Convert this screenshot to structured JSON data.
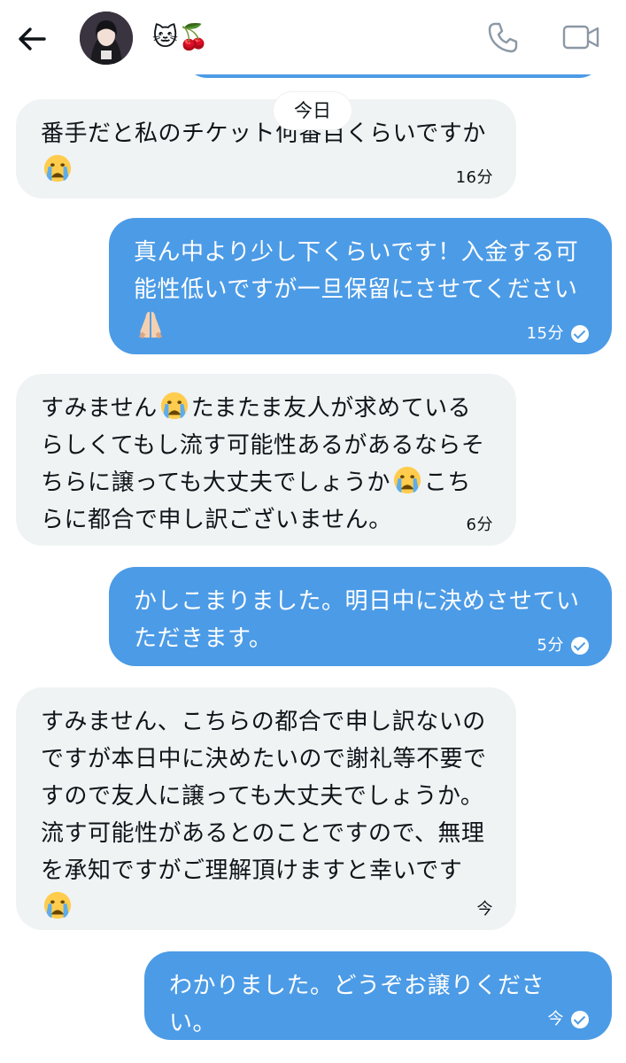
{
  "header": {
    "contact_name": "🐱🍒",
    "icons": [
      "back-arrow-icon",
      "phone-icon",
      "video-camera-icon"
    ]
  },
  "date_divider": "今日",
  "messages": [
    {
      "direction": "received",
      "text_1": "番手だと私のチケット何番目くらいですか",
      "emoji_1": "crying-face",
      "time": "16分"
    },
    {
      "direction": "sent",
      "text_1": "真ん中より少し下くらいです！入金する可能性低いですが一旦保留にさせてください",
      "emoji_1": "folded-hands",
      "time": "15分",
      "read": true
    },
    {
      "direction": "received",
      "text_1": "すみません",
      "emoji_1": "crying-face",
      "text_2": "たまたま友人が求めているらしくてもし流す可能性あるがあるならそちらに譲っても大丈夫でしょうか",
      "emoji_2": "crying-face",
      "text_3": "こちらに都合で申し訳ございません。",
      "time": "6分"
    },
    {
      "direction": "sent",
      "text_1": "かしこまりました。明日中に決めさせていただきます。",
      "time": "5分",
      "read": true
    },
    {
      "direction": "received",
      "text_1": "すみません、こちらの都合で申し訳ないのですが本日中に決めたいので謝礼等不要ですので友人に譲っても大丈夫でしょうか。流す可能性があるとのことですので、無理を承知ですがご理解頂けますと幸いです",
      "emoji_1": "crying-face",
      "time": "今"
    },
    {
      "direction": "sent",
      "text_1": "わかりました。どうぞお譲りください。",
      "time": "今",
      "read": true
    }
  ],
  "colors": {
    "sent_bubble": "#4c9be6",
    "received_bubble": "#eff3f4",
    "text": "#0f1419"
  }
}
